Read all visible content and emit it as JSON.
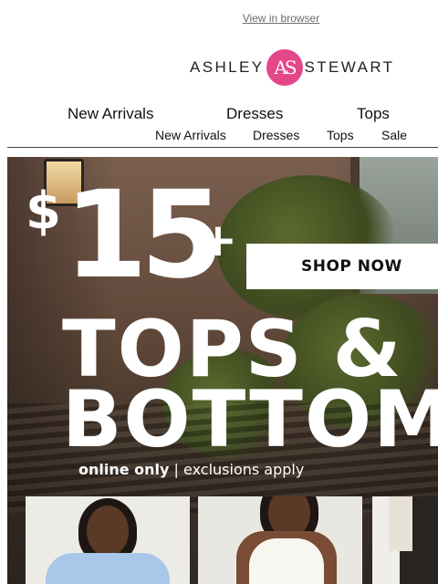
{
  "header": {
    "view_in_browser": "View in browser",
    "brand_left": "ASHLEY",
    "brand_mark": "AS",
    "brand_right": "STEWART",
    "brand_color": "#e4468a"
  },
  "nav_primary": [
    "New Arrivals",
    "Dresses",
    "Tops"
  ],
  "nav_secondary": [
    "New Arrivals",
    "Dresses",
    "Tops",
    "Sale"
  ],
  "hero": {
    "currency": "$",
    "price": "15",
    "plus": "+",
    "cta": "SHOP NOW",
    "headline_line1": "TOPS &",
    "headline_line2": "BOTTOMS",
    "sub_bold": "online only",
    "sub_sep": " | ",
    "sub_rest": "exclusions apply"
  }
}
